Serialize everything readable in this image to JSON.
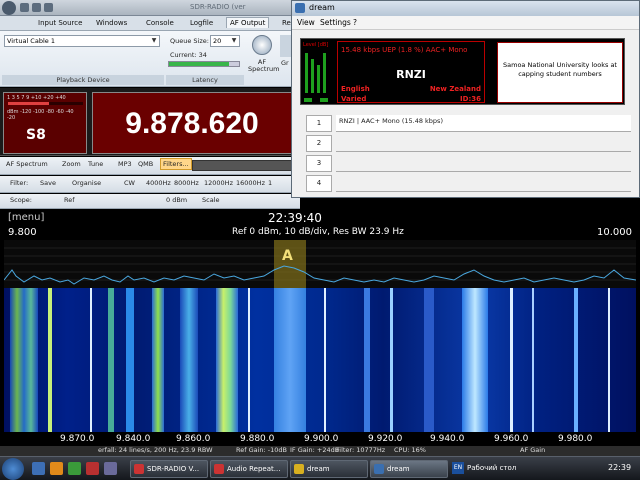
{
  "sdr": {
    "title": "SDR-RADIO (ver",
    "tabs": [
      "Input Source",
      "Windows",
      "Console",
      "Logfile",
      "AF Output",
      "Re"
    ],
    "active_tab": "AF Output",
    "playback_device": "Virtual Cable 1",
    "playback_device_label": "Playback Device",
    "queue_size_label": "Queue Size:",
    "queue_size": "20",
    "current_label": "Current: 34",
    "latency_label": "Latency",
    "current_progress": 0.85,
    "af_spectrum_btn": "AF Spectrum",
    "eq_btn": "Gr Eq",
    "meter_scale_top": "1  3  5  7  9  +10 +20 +40",
    "meter_scale_bottom": "dBm -120 -100 -80 -60 -40 -20",
    "meter_level": 0.55,
    "s_reading": "S8",
    "frequency": "9.878.620",
    "toolbar1": [
      "AF Spectrum",
      "Zoom",
      "Tune",
      "MP3",
      "QMB",
      "Filters..."
    ],
    "toolbar2": [
      "Filter:",
      "Save",
      "Organise",
      "CW",
      "4000Hz",
      "8000Hz",
      "12000Hz",
      "16000Hz",
      "1"
    ],
    "toolbar3": [
      "Scope:",
      "Ref",
      "0 dBm",
      "Scale"
    ]
  },
  "dream": {
    "title": "dream",
    "menu": [
      "View",
      "Settings",
      "?"
    ],
    "level_label": "Level [dB]",
    "bitrate_line": "15.48 kbps UEP (1.8 %)  AAC+  Mono",
    "station": "RNZI",
    "language": "English",
    "country": "New Zealand",
    "program_type": "Varied",
    "service_id": "ID:36",
    "news_text": "Samoa National University looks at capping student numbers",
    "services": [
      {
        "num": "1",
        "label": "RNZI  |  AAC+ Mono (15.48 kbps)"
      },
      {
        "num": "2",
        "label": ""
      },
      {
        "num": "3",
        "label": ""
      },
      {
        "num": "4",
        "label": ""
      }
    ]
  },
  "spectrum": {
    "menu": "[menu]",
    "time": "22:39:40",
    "start_freq": "9.800",
    "end_freq": "10.000",
    "info": "Ref 0 dBm,  10 dB/div,  Res BW 23.9 Hz",
    "marker": "A",
    "axis_ticks": [
      "9.870.0",
      "9.840.0",
      "9.860.0",
      "9.880.0",
      "9.900.0",
      "9.920.0",
      "9.940.0",
      "9.960.0",
      "9.980.0"
    ],
    "status_strip": [
      "erfall: 24 lines/s, 200 Hz, 23.9 RBW",
      "Ref Gain: -10dB",
      "IF Gain: +24dB",
      "Filter: 10777Hz",
      "CPU: 16%",
      "AF Gain"
    ]
  },
  "taskbar": {
    "tasks": [
      "SDR-RADIO V...",
      "Audio Repeat...",
      "dream",
      "dream"
    ],
    "lang": "EN",
    "desktop": "Рабочий стол",
    "clock": "22:39"
  }
}
